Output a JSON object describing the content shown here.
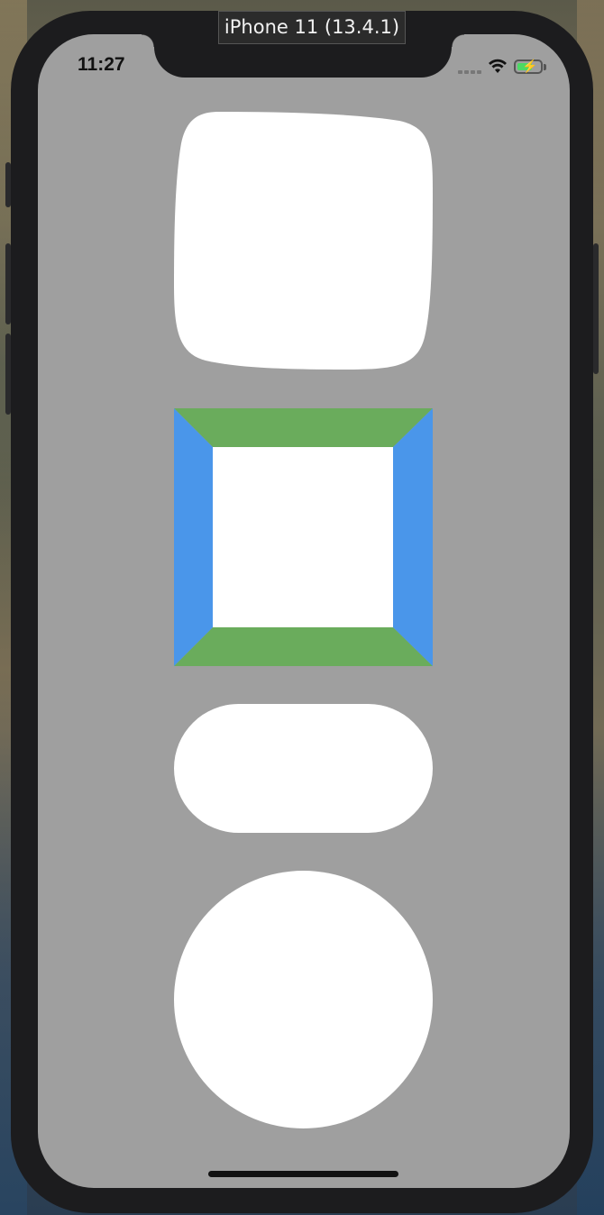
{
  "simulator": {
    "title": "iPhone 11 (13.4.1)"
  },
  "status_bar": {
    "time": "11:27",
    "wifi_icon": "wifi-icon",
    "battery_icon": "battery-charging-icon",
    "signal_icon": "cellular-signal-icon"
  },
  "colors": {
    "screen_background": "#9f9f9f",
    "shape_fill": "#ffffff",
    "border_top_bottom": "#6aac5c",
    "border_left_right": "#4a96ea",
    "battery_fill": "#4cd964",
    "bezel": "#1c1c1e"
  },
  "shapes": [
    {
      "kind": "squircle",
      "fill": "white"
    },
    {
      "kind": "bordered-square",
      "fill": "white",
      "border": "green top/bottom, blue left/right"
    },
    {
      "kind": "pill",
      "fill": "white"
    },
    {
      "kind": "circle",
      "fill": "white"
    }
  ]
}
